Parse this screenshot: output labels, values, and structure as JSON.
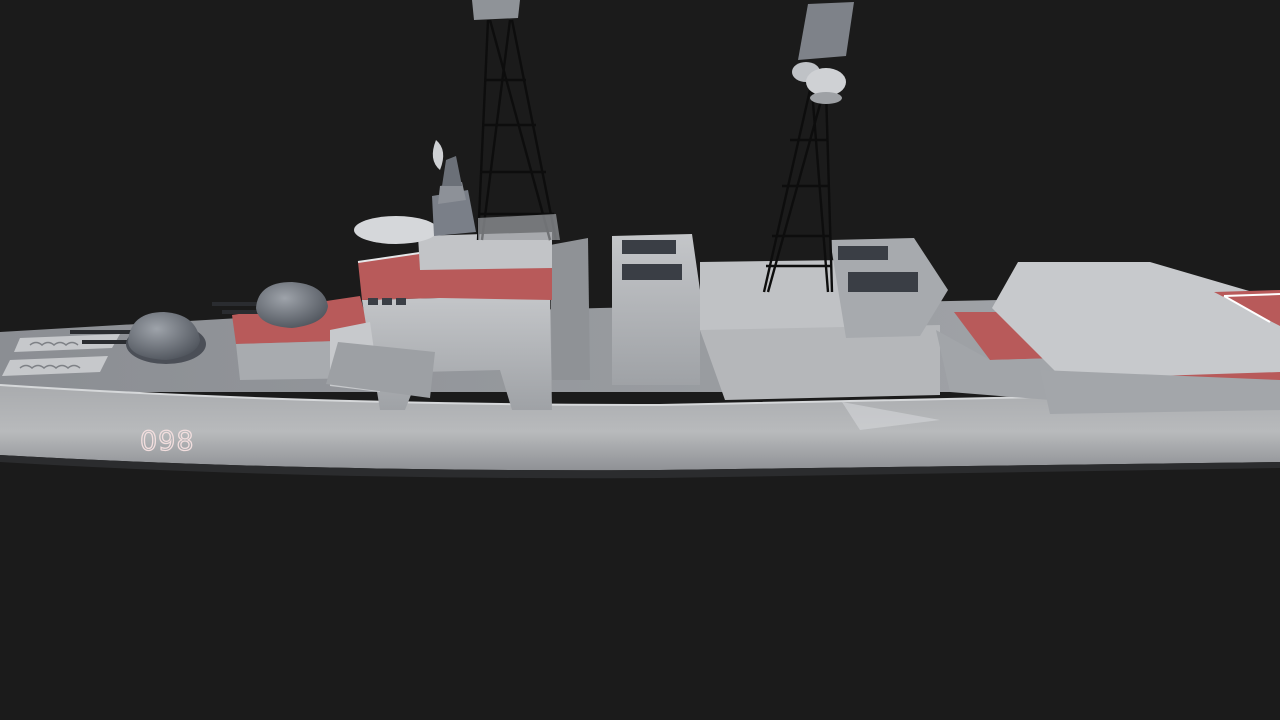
{
  "scene": {
    "background": "#1b1b1b",
    "subject": "ship",
    "hull_number": "098"
  },
  "colors": {
    "hull_light": "#b9bbbd",
    "hull_mid": "#9a9c9f",
    "hull_dark": "#6e7176",
    "deck_red": "#b85a5a",
    "mast": "#0d0d0d",
    "window": "#3a3e45"
  }
}
